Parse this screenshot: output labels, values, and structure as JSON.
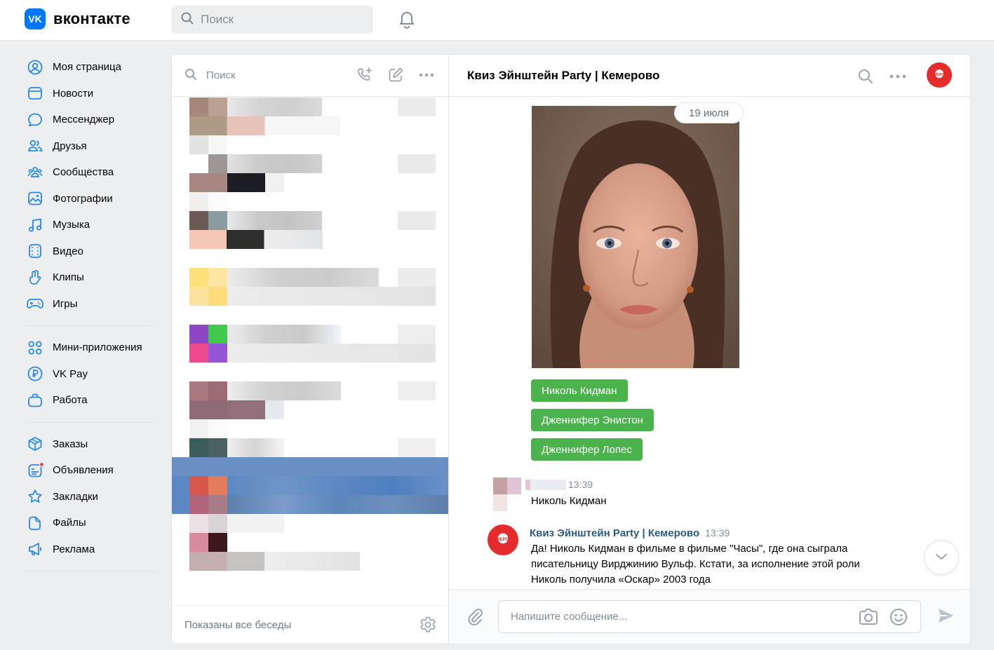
{
  "header": {
    "logo_mark": "VK",
    "logo_text": "вконтакте",
    "search_placeholder": "Поиск",
    "icons": {
      "search": "search-icon",
      "notifications": "bell-icon"
    }
  },
  "sidebar": {
    "group1": [
      {
        "label": "Моя страница",
        "icon": "user-circle-icon"
      },
      {
        "label": "Новости",
        "icon": "newsfeed-icon"
      },
      {
        "label": "Мессенджер",
        "icon": "message-icon"
      },
      {
        "label": "Друзья",
        "icon": "friends-icon"
      },
      {
        "label": "Сообщества",
        "icon": "communities-icon"
      },
      {
        "label": "Фотографии",
        "icon": "photos-icon"
      },
      {
        "label": "Музыка",
        "icon": "music-icon"
      },
      {
        "label": "Видео",
        "icon": "video-icon"
      },
      {
        "label": "Клипы",
        "icon": "clips-icon"
      },
      {
        "label": "Игры",
        "icon": "gamepad-icon"
      }
    ],
    "group2": [
      {
        "label": "Мини-приложения",
        "icon": "apps-grid-icon"
      },
      {
        "label": "VK Pay",
        "icon": "vkpay-icon"
      },
      {
        "label": "Работа",
        "icon": "briefcase-icon"
      }
    ],
    "group3": [
      {
        "label": "Заказы",
        "icon": "box-icon"
      },
      {
        "label": "Объявления",
        "icon": "classifieds-icon"
      },
      {
        "label": "Закладки",
        "icon": "star-icon"
      },
      {
        "label": "Файлы",
        "icon": "file-icon"
      },
      {
        "label": "Реклама",
        "icon": "megaphone-icon"
      }
    ]
  },
  "chat_list": {
    "search_placeholder": "Поиск",
    "footer_label": "Показаны все беседы",
    "active_color": "#5b88c5"
  },
  "conversation": {
    "title": "Квиз Эйнштейн Party | Кемерово",
    "avatar_text": "КЕМЕРОВО",
    "date_label": "19 июля",
    "keyboard_buttons": [
      "Николь Кидман",
      "Дженнифер Энистон",
      "Дженнифер Лопес"
    ],
    "button_color": "#4bb34b",
    "messages": [
      {
        "author": "",
        "time": "13:39",
        "text": "Николь Кидман"
      },
      {
        "author": "Квиз Эйнштейн Party | Кемерово",
        "time": "13:39",
        "lines": [
          "Да! Николь Кидман в фильме в фильме \"Часы\", где она сыграла",
          "писательницу Вирджинию Вульф. Кстати, за исполнение этой роли",
          "Николь получила «Оскар» 2003 года"
        ]
      }
    ],
    "composer_placeholder": "Напишите сообщение..."
  }
}
